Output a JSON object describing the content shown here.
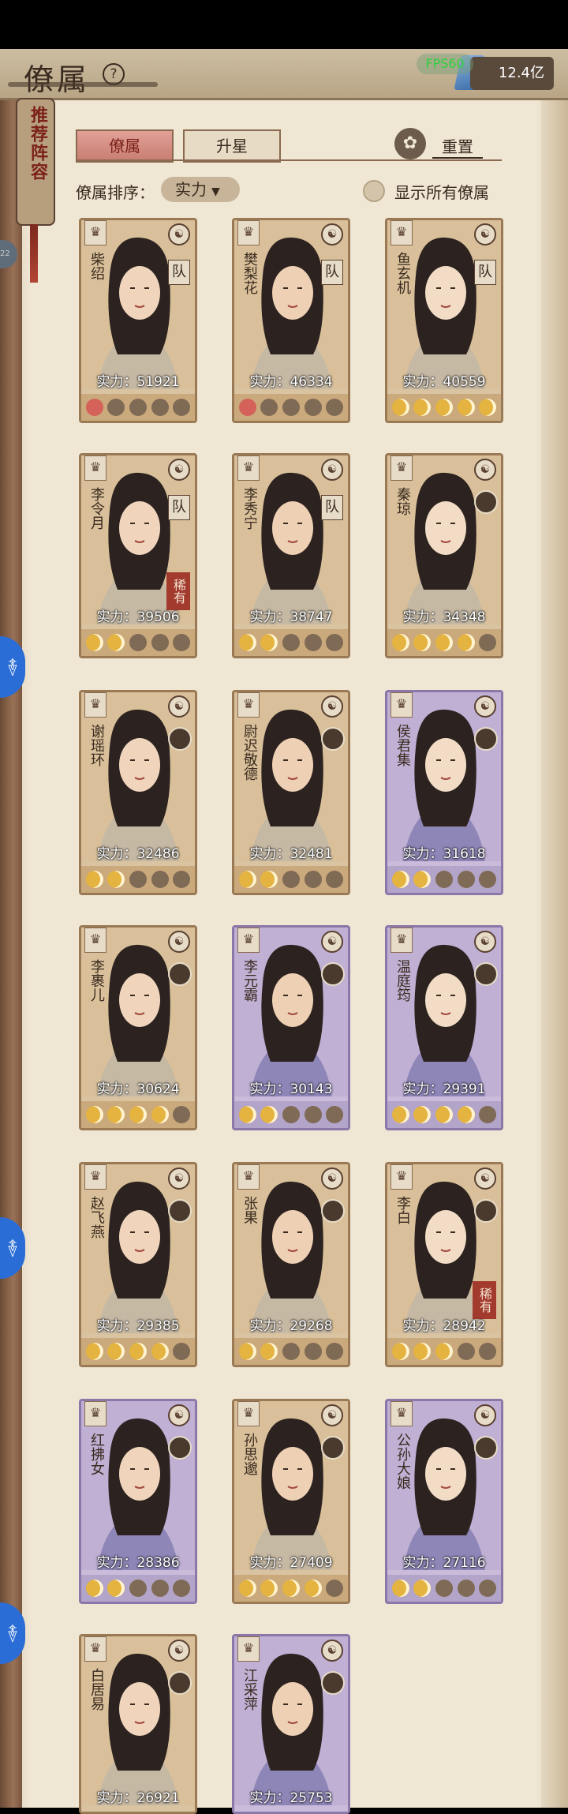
{
  "header": {
    "title": "僚属",
    "help_icon": "?",
    "fps": "FPS60",
    "currency_value": "12.4亿"
  },
  "side_tab": {
    "label": "推荐阵容"
  },
  "side_dot": "22",
  "side_button_icon": "࿈",
  "tabs": [
    {
      "label": "僚属",
      "active": true
    },
    {
      "label": "升星",
      "active": false
    }
  ],
  "reset": {
    "label": "重置"
  },
  "sort": {
    "label": "僚属排序：",
    "value": "实力"
  },
  "show_all": {
    "label": "显示所有僚属"
  },
  "cards": [
    {
      "name": "柴绍",
      "power": "实力：51921",
      "team": "队",
      "rare": "",
      "theme": "gold",
      "stars": [
        "red",
        "off",
        "off",
        "off",
        "off"
      ]
    },
    {
      "name": "樊梨花",
      "power": "实力：46334",
      "team": "队",
      "rare": "",
      "theme": "gold",
      "stars": [
        "red",
        "off",
        "off",
        "off",
        "off"
      ]
    },
    {
      "name": "鱼玄机",
      "power": "实力：40559",
      "team": "队",
      "rare": "",
      "theme": "gold",
      "stars": [
        "on",
        "on",
        "on",
        "on",
        "on"
      ]
    },
    {
      "name": "李令月",
      "power": "实力：39506",
      "team": "队",
      "rare": "稀有",
      "theme": "gold",
      "stars": [
        "on",
        "on",
        "off",
        "off",
        "off"
      ]
    },
    {
      "name": "李秀宁",
      "power": "实力：38747",
      "team": "队",
      "rare": "",
      "theme": "gold",
      "stars": [
        "on",
        "on",
        "off",
        "off",
        "off"
      ]
    },
    {
      "name": "秦琼",
      "power": "实力：34348",
      "team": "",
      "rare": "",
      "theme": "gold",
      "stars": [
        "on",
        "on",
        "on",
        "on",
        "off"
      ]
    },
    {
      "name": "谢瑶环",
      "power": "实力：32486",
      "team": "",
      "rare": "",
      "theme": "gold",
      "stars": [
        "on",
        "on",
        "off",
        "off",
        "off"
      ]
    },
    {
      "name": "尉迟敬德",
      "power": "实力：32481",
      "team": "",
      "rare": "",
      "theme": "gold",
      "stars": [
        "on",
        "on",
        "off",
        "off",
        "off"
      ]
    },
    {
      "name": "侯君集",
      "power": "实力：31618",
      "team": "",
      "rare": "",
      "theme": "purple",
      "stars": [
        "on",
        "on",
        "off",
        "off",
        "off"
      ]
    },
    {
      "name": "李裹儿",
      "power": "实力：30624",
      "team": "",
      "rare": "",
      "theme": "gold",
      "stars": [
        "on",
        "on",
        "on",
        "on",
        "off"
      ]
    },
    {
      "name": "李元霸",
      "power": "实力：30143",
      "team": "",
      "rare": "",
      "theme": "purple",
      "stars": [
        "on",
        "on",
        "off",
        "off",
        "off"
      ]
    },
    {
      "name": "温庭筠",
      "power": "实力：29391",
      "team": "",
      "rare": "",
      "theme": "purple",
      "stars": [
        "on",
        "on",
        "on",
        "on",
        "off"
      ]
    },
    {
      "name": "赵飞燕",
      "power": "实力：29385",
      "team": "",
      "rare": "",
      "theme": "gold",
      "stars": [
        "on",
        "on",
        "on",
        "on",
        "off"
      ]
    },
    {
      "name": "张果",
      "power": "实力：29268",
      "team": "",
      "rare": "",
      "theme": "gold",
      "stars": [
        "on",
        "on",
        "off",
        "off",
        "off"
      ]
    },
    {
      "name": "李白",
      "power": "实力：28942",
      "team": "",
      "rare": "稀有",
      "theme": "gold",
      "stars": [
        "on",
        "on",
        "on",
        "off",
        "off"
      ]
    },
    {
      "name": "红拂女",
      "power": "实力：28386",
      "team": "",
      "rare": "",
      "theme": "purple",
      "stars": [
        "on",
        "on",
        "off",
        "off",
        "off"
      ]
    },
    {
      "name": "孙思邈",
      "power": "实力：27409",
      "team": "",
      "rare": "",
      "theme": "gold",
      "stars": [
        "on",
        "on",
        "on",
        "on",
        "off"
      ]
    },
    {
      "name": "公孙大娘",
      "power": "实力：27116",
      "team": "",
      "rare": "",
      "theme": "purple",
      "stars": [
        "on",
        "on",
        "off",
        "off",
        "off"
      ]
    },
    {
      "name": "白居易",
      "power": "实力：26921",
      "team": "",
      "rare": "",
      "theme": "gold",
      "stars": []
    },
    {
      "name": "江采萍",
      "power": "实力：25753",
      "team": "",
      "rare": "",
      "theme": "purple",
      "stars": []
    }
  ]
}
